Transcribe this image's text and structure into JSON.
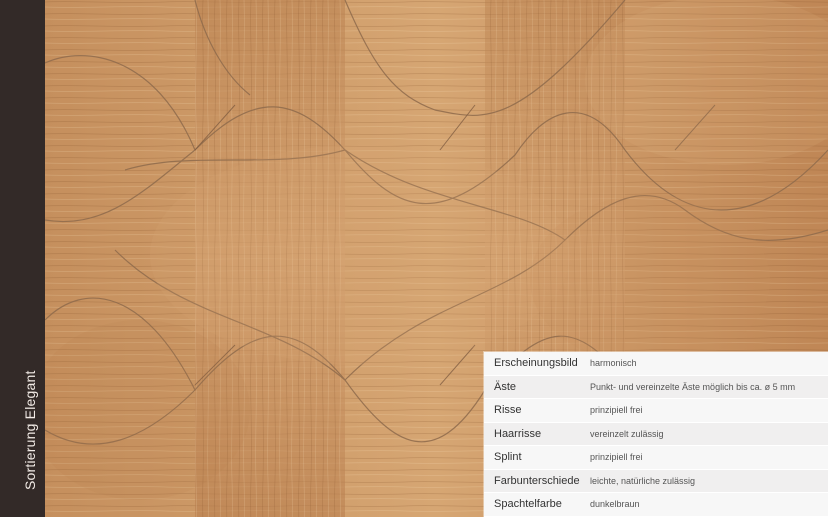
{
  "sidebar": {
    "title": "Sortierung Elegant"
  },
  "image": {
    "description_icon": "wood-parquet-image"
  },
  "colors": {
    "sidebar_bg": "#332a28",
    "sidebar_text": "#f2ebe6",
    "wood_base": "#c79463",
    "wood_dark": "#a96f43",
    "wood_light": "#deb58c",
    "panel_bg": "#f7f7f7"
  },
  "specs": [
    {
      "label": "Erscheinungsbild",
      "value": "harmonisch"
    },
    {
      "label": "Äste",
      "value": "Punkt- und vereinzelte Äste möglich bis ca. ø 5 mm"
    },
    {
      "label": "Risse",
      "value": "prinzipiell frei"
    },
    {
      "label": "Haarrisse",
      "value": "vereinzelt zulässig"
    },
    {
      "label": "Splint",
      "value": "prinzipiell frei"
    },
    {
      "label": "Farbunterschiede",
      "value": "leichte, natürliche zulässig"
    },
    {
      "label": "Spachtelfarbe",
      "value": "dunkelbraun"
    }
  ]
}
